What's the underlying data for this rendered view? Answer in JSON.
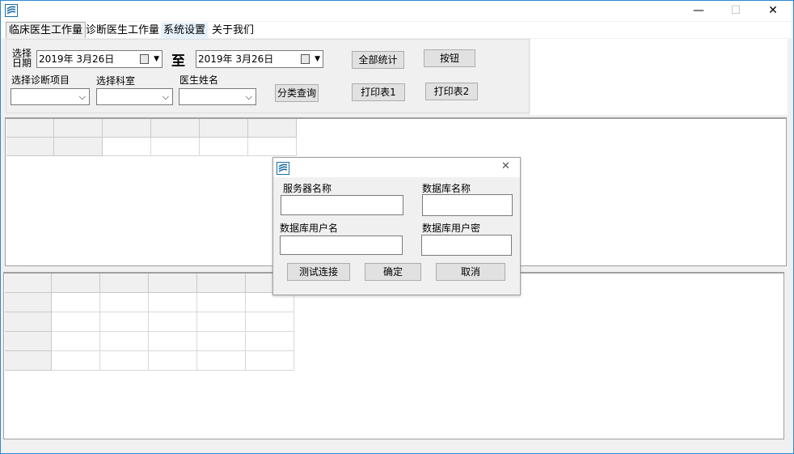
{
  "window": {
    "icon": "app-logo-icon",
    "controls": {
      "minimize": "—",
      "maximize": "☐",
      "close": "✕"
    }
  },
  "menu": [
    "临床医生工作量",
    "诊断医生工作量",
    "系统设置",
    "关于我们"
  ],
  "filters": {
    "select_date_label_top": "选择",
    "select_date_label_bottom": "日期",
    "date_from": "2019年  3月26日",
    "to_label": "至",
    "date_to": "2019年  3月26日",
    "diag_item_label": "选择诊断项目",
    "dept_label": "选择科室",
    "doctor_label": "医生姓名",
    "diag_item_value": "",
    "dept_value": "",
    "doctor_value": ""
  },
  "buttons": {
    "all_stats": "全部统计",
    "button": "按钮",
    "category_query": "分类查询",
    "print1": "打印表1",
    "print2": "打印表2"
  },
  "dialog": {
    "icon": "app-logo-icon",
    "close": "✕",
    "server_name_label": "服务器名称",
    "db_name_label": "数据库名称",
    "db_user_label": "数据库用户名",
    "db_password_label": "数据库用户密",
    "server_name_value": "",
    "db_name_value": "",
    "db_user_value": "",
    "db_password_value": "",
    "test_button": "测试连接",
    "ok_button": "确定",
    "cancel_button": "取消"
  },
  "colors": {
    "accent": "#2d89d6",
    "logo": "#1d6fa5"
  }
}
